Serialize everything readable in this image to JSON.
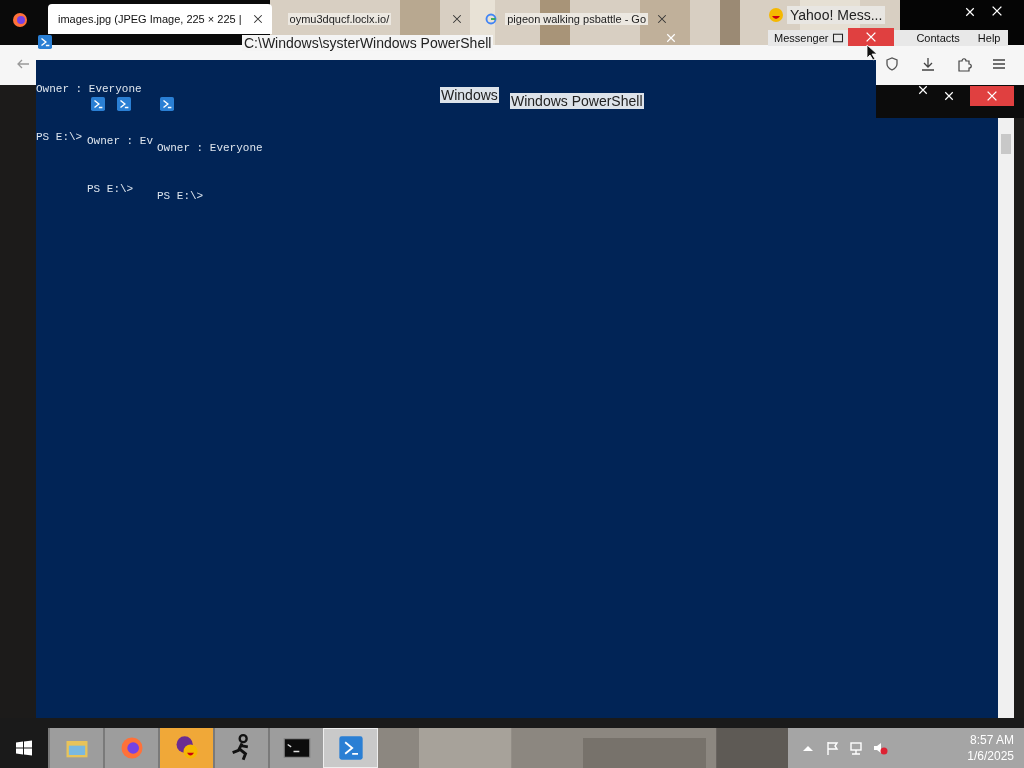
{
  "browser": {
    "tabs": [
      {
        "title": "images.jpg (JPEG Image, 225 × 225 |",
        "selected": true
      },
      {
        "title": "oymu3dqucf.loclx.io/",
        "selected": false
      },
      {
        "title": "pigeon walking psbattle - Go",
        "selected": false
      }
    ]
  },
  "messenger": {
    "title": "Yahoo! Mess...",
    "menu": [
      "Messenger",
      "Contacts",
      "Help"
    ]
  },
  "powershell": {
    "title": "C:\\Windows\\systerWindows PowerShell",
    "overlay_titles": [
      "Windows",
      "Windows PowerShell"
    ],
    "panes": [
      {
        "lines": [
          "Owner : Everyone",
          "PS E:\\>"
        ]
      },
      {
        "lines": [
          "Owner : Ev",
          "PS E:\\>"
        ]
      },
      {
        "lines": [
          "Owner : Everyone",
          "PS E:\\>"
        ]
      }
    ]
  },
  "taskbar": {
    "apps": [
      {
        "kind": "explorer",
        "selected": false,
        "flashing": false
      },
      {
        "kind": "firefox",
        "selected": false,
        "flashing": false
      },
      {
        "kind": "yahoo",
        "selected": false,
        "flashing": true
      },
      {
        "kind": "aim",
        "selected": false,
        "flashing": false
      },
      {
        "kind": "cmd",
        "selected": false,
        "flashing": false
      },
      {
        "kind": "powershell",
        "selected": true,
        "flashing": false
      }
    ],
    "clock": {
      "time": "8:57 AM",
      "date": "1/6/2025"
    }
  }
}
